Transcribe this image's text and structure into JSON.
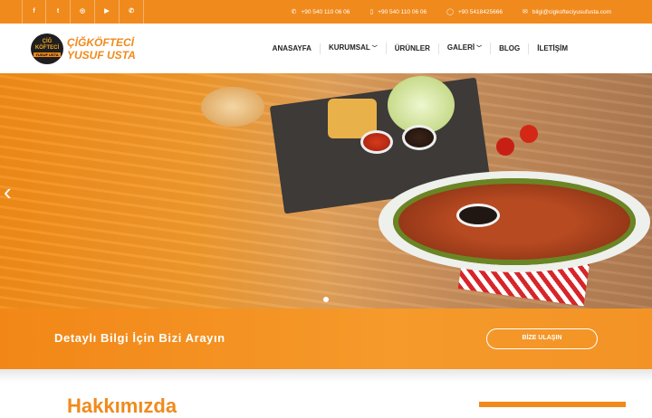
{
  "topbar": {
    "social": [
      {
        "icon": "facebook-icon",
        "glyph": "f"
      },
      {
        "icon": "tumblr-icon",
        "glyph": "t"
      },
      {
        "icon": "instagram-icon",
        "glyph": "◎"
      },
      {
        "icon": "youtube-icon",
        "glyph": "▶"
      },
      {
        "icon": "whatsapp-icon",
        "glyph": "✆"
      }
    ],
    "phone1": "+90 540 110 06 06",
    "phone2": "+90 540 110 06 06",
    "whatsapp": "+90 5418425666",
    "email": "bilgi@cigkofteciyusufusta.com"
  },
  "logo": {
    "badge_line1": "ÇİĞ",
    "badge_line2": "KÖFTECİ",
    "badge_line3": "YUSUF USTA",
    "text_line1": "ÇİĞKÖFTECİ",
    "text_line2": "YUSUF USTA"
  },
  "nav": {
    "items": [
      "ANASAYFA",
      "KURUMSAL",
      "ÜRÜNLER",
      "GALERİ",
      "BLOG",
      "İLETİŞİM"
    ]
  },
  "hero": {
    "prev_arrow": "‹"
  },
  "cta": {
    "text": "Detaylı Bilgi İçin Bizi Arayın",
    "button": "BİZE ULAŞIN"
  },
  "about": {
    "heading": "Hakkımızda"
  },
  "colors": {
    "accent": "#f08a1c"
  }
}
